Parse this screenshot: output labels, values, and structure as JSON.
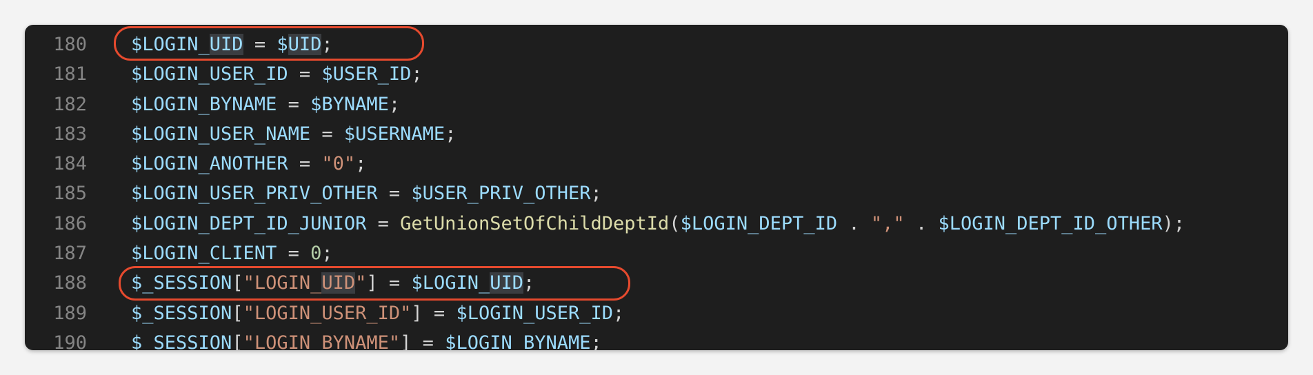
{
  "editor": {
    "lines": [
      {
        "number": "180",
        "tokens": [
          {
            "t": "$LOGIN_",
            "c": "var"
          },
          {
            "t": "UID",
            "c": "var hl"
          },
          {
            "t": " = ",
            "c": "op"
          },
          {
            "t": "$",
            "c": "var"
          },
          {
            "t": "UID",
            "c": "var hl"
          },
          {
            "t": ";",
            "c": "op"
          }
        ]
      },
      {
        "number": "181",
        "tokens": [
          {
            "t": "$LOGIN_USER_ID",
            "c": "var"
          },
          {
            "t": " = ",
            "c": "op"
          },
          {
            "t": "$USER_ID",
            "c": "var"
          },
          {
            "t": ";",
            "c": "op"
          }
        ]
      },
      {
        "number": "182",
        "tokens": [
          {
            "t": "$LOGIN_BYNAME",
            "c": "var"
          },
          {
            "t": " = ",
            "c": "op"
          },
          {
            "t": "$BYNAME",
            "c": "var"
          },
          {
            "t": ";",
            "c": "op"
          }
        ]
      },
      {
        "number": "183",
        "tokens": [
          {
            "t": "$LOGIN_USER_NAME",
            "c": "var"
          },
          {
            "t": " = ",
            "c": "op"
          },
          {
            "t": "$USERNAME",
            "c": "var"
          },
          {
            "t": ";",
            "c": "op"
          }
        ]
      },
      {
        "number": "184",
        "tokens": [
          {
            "t": "$LOGIN_ANOTHER",
            "c": "var"
          },
          {
            "t": " = ",
            "c": "op"
          },
          {
            "t": "\"0\"",
            "c": "str"
          },
          {
            "t": ";",
            "c": "op"
          }
        ]
      },
      {
        "number": "185",
        "tokens": [
          {
            "t": "$LOGIN_USER_PRIV_OTHER",
            "c": "var"
          },
          {
            "t": " = ",
            "c": "op"
          },
          {
            "t": "$USER_PRIV_OTHER",
            "c": "var"
          },
          {
            "t": ";",
            "c": "op"
          }
        ]
      },
      {
        "number": "186",
        "tokens": [
          {
            "t": "$LOGIN_DEPT_ID_JUNIOR",
            "c": "var"
          },
          {
            "t": " = ",
            "c": "op"
          },
          {
            "t": "GetUnionSetOfChildDeptId",
            "c": "fn"
          },
          {
            "t": "(",
            "c": "op"
          },
          {
            "t": "$LOGIN_DEPT_ID",
            "c": "var"
          },
          {
            "t": " . ",
            "c": "op"
          },
          {
            "t": "\",\"",
            "c": "str"
          },
          {
            "t": " . ",
            "c": "op"
          },
          {
            "t": "$LOGIN_DEPT_ID_OTHER",
            "c": "var"
          },
          {
            "t": ");",
            "c": "op"
          }
        ]
      },
      {
        "number": "187",
        "tokens": [
          {
            "t": "$LOGIN_CLIENT",
            "c": "var"
          },
          {
            "t": " = ",
            "c": "op"
          },
          {
            "t": "0",
            "c": "num"
          },
          {
            "t": ";",
            "c": "op"
          }
        ]
      },
      {
        "number": "188",
        "tokens": [
          {
            "t": "$_SESSION",
            "c": "var"
          },
          {
            "t": "[",
            "c": "op"
          },
          {
            "t": "\"LOGIN_",
            "c": "str"
          },
          {
            "t": "UID",
            "c": "str hl"
          },
          {
            "t": "\"",
            "c": "str"
          },
          {
            "t": "] = ",
            "c": "op"
          },
          {
            "t": "$LOGIN_",
            "c": "var"
          },
          {
            "t": "UID",
            "c": "var hl"
          },
          {
            "t": ";",
            "c": "op"
          }
        ]
      },
      {
        "number": "189",
        "tokens": [
          {
            "t": "$_SESSION",
            "c": "var"
          },
          {
            "t": "[",
            "c": "op"
          },
          {
            "t": "\"LOGIN_USER_ID\"",
            "c": "str"
          },
          {
            "t": "] = ",
            "c": "op"
          },
          {
            "t": "$LOGIN_USER_ID",
            "c": "var"
          },
          {
            "t": ";",
            "c": "op"
          }
        ]
      },
      {
        "number": "190",
        "tokens": [
          {
            "t": "$_SESSION",
            "c": "var"
          },
          {
            "t": "[",
            "c": "op"
          },
          {
            "t": "\"LOGIN_BYNAME\"",
            "c": "str"
          },
          {
            "t": "] = ",
            "c": "op"
          },
          {
            "t": "$LOGIN_BYNAME",
            "c": "var"
          },
          {
            "t": ";",
            "c": "op"
          }
        ]
      }
    ]
  },
  "colors": {
    "background": "#1e1e1e",
    "line_number": "#858585",
    "variable": "#9cdcfe",
    "string": "#ce9178",
    "number": "#b5cea8",
    "function": "#dcdcaa",
    "annotation": "#e64a2e"
  }
}
